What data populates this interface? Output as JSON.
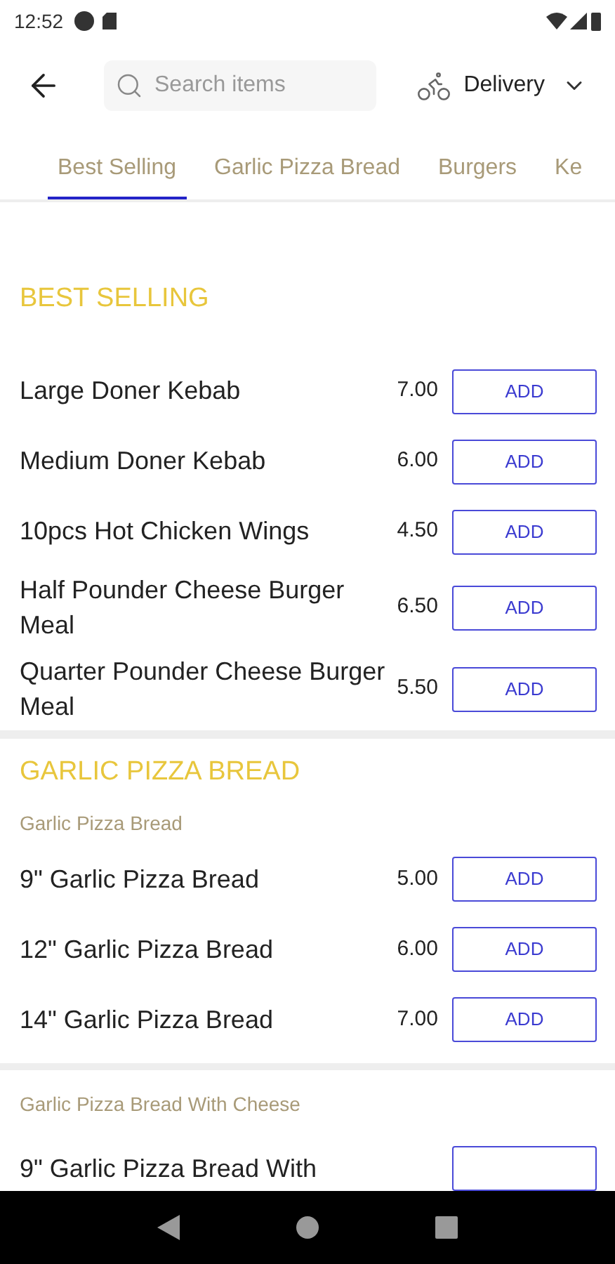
{
  "status_bar": {
    "time": "12:52"
  },
  "header": {
    "search": {
      "placeholder": "Search items"
    },
    "order_mode": "Delivery"
  },
  "tabs": [
    {
      "label": "Best Selling",
      "selected": true
    },
    {
      "label": "Garlic Pizza Bread",
      "selected": false
    },
    {
      "label": "Burgers",
      "selected": false
    },
    {
      "label": "Ke",
      "selected": false
    }
  ],
  "sections": [
    {
      "title": "BEST SELLING",
      "groups": [
        {
          "items": [
            {
              "name": "Large Doner Kebab",
              "price": "7.00",
              "button": "ADD"
            },
            {
              "name": "Medium Doner Kebab",
              "price": "6.00",
              "button": "ADD"
            },
            {
              "name": "10pcs Hot Chicken Wings",
              "price": "4.50",
              "button": "ADD"
            },
            {
              "name": "Half Pounder Cheese Burger Meal",
              "price": "6.50",
              "button": "ADD"
            },
            {
              "name": "Quarter Pounder Cheese Burger Meal",
              "price": "5.50",
              "button": "ADD"
            }
          ]
        }
      ]
    },
    {
      "title": "GARLIC PIZZA BREAD",
      "groups": [
        {
          "subtitle": "Garlic Pizza Bread",
          "items": [
            {
              "name": "9\" Garlic Pizza Bread",
              "price": "5.00",
              "button": "ADD"
            },
            {
              "name": "12\" Garlic Pizza Bread",
              "price": "6.00",
              "button": "ADD"
            },
            {
              "name": "14\" Garlic Pizza Bread",
              "price": "7.00",
              "button": "ADD"
            }
          ]
        },
        {
          "subtitle": "Garlic Pizza Bread With Cheese",
          "items": [
            {
              "name": "9\" Garlic Pizza Bread With"
            }
          ]
        }
      ]
    }
  ]
}
